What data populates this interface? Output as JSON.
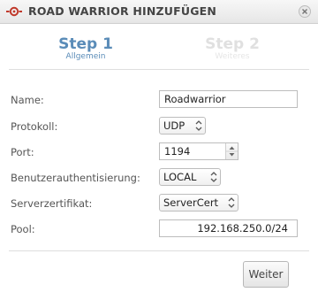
{
  "window": {
    "title": "ROAD WARRIOR HINZUFÜGEN"
  },
  "icons": {
    "app": "road-warrior-icon",
    "close": "close-icon",
    "select_arrow": "up-down-arrow-icon",
    "spinner": "spinner-arrows-icon"
  },
  "steps": [
    {
      "title": "Step 1",
      "subtitle": "Allgemein",
      "active": true
    },
    {
      "title": "Step 2",
      "subtitle": "Weiteres",
      "active": false
    }
  ],
  "form": {
    "name": {
      "label": "Name:",
      "value": "Roadwarrior"
    },
    "protokoll": {
      "label": "Protokoll:",
      "value": "UDP"
    },
    "port": {
      "label": "Port:",
      "value": "1194"
    },
    "auth": {
      "label": "Benutzerauthentisierung:",
      "value": "LOCAL"
    },
    "cert": {
      "label": "Serverzertifikat:",
      "value": "ServerCert"
    },
    "pool": {
      "label": "Pool:",
      "value": "192.168.250.0/24"
    }
  },
  "buttons": {
    "next": "Weiter"
  },
  "colors": {
    "accent": "#5a8cb8",
    "icon_red": "#c0392b"
  }
}
